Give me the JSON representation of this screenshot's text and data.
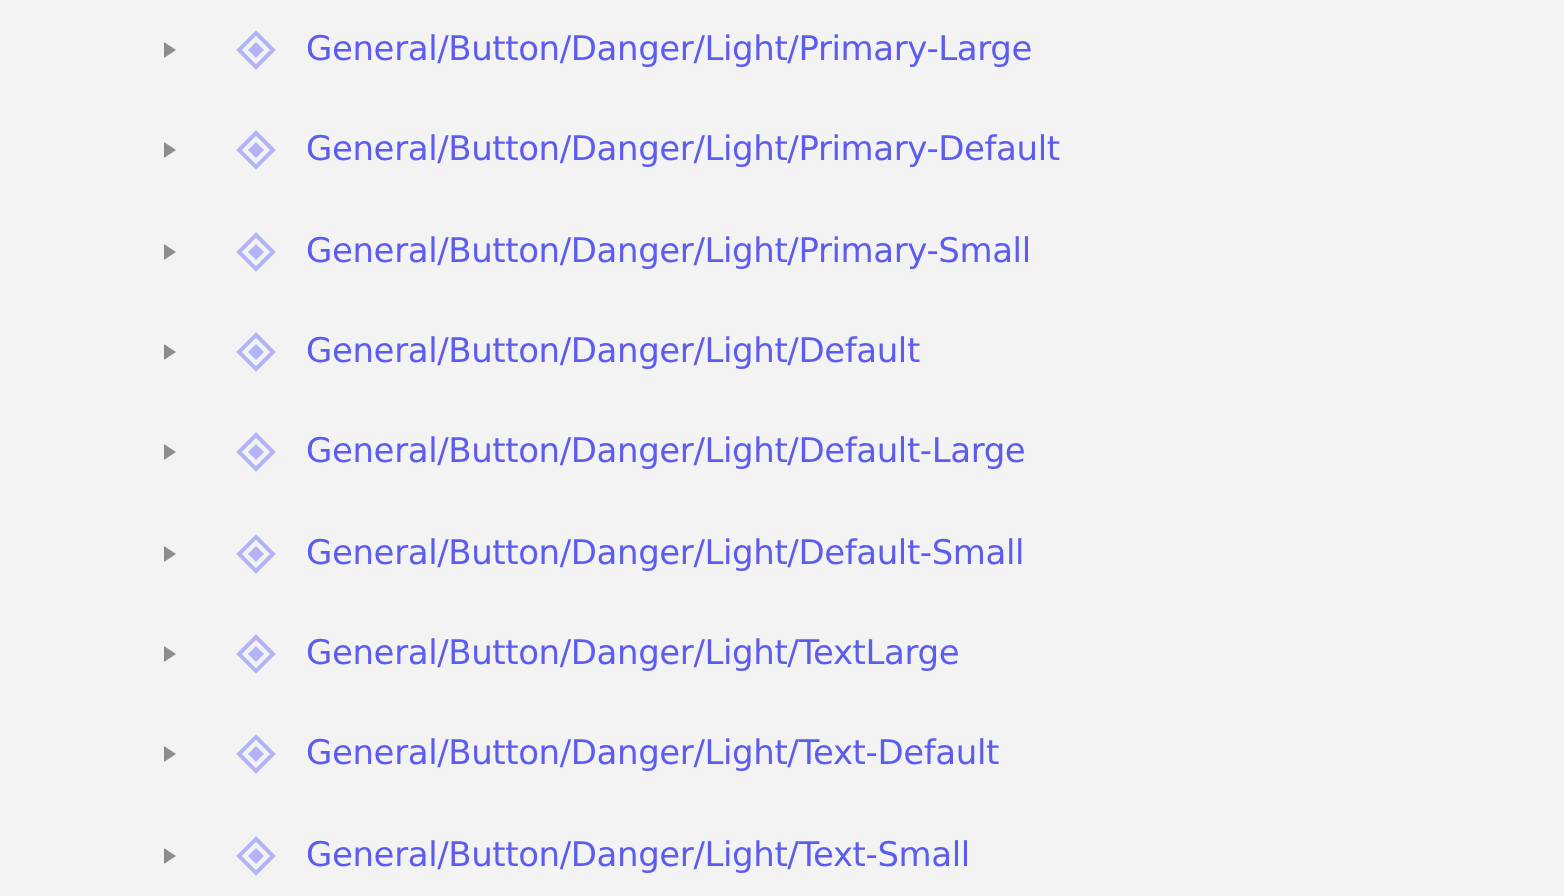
{
  "layers": [
    {
      "name": "General/Button/Danger/Light/Primary-Large",
      "expanded": false
    },
    {
      "name": "General/Button/Danger/Light/Primary-Default",
      "expanded": false
    },
    {
      "name": "General/Button/Danger/Light/Primary-Small",
      "expanded": false
    },
    {
      "name": "General/Button/Danger/Light/Default",
      "expanded": false
    },
    {
      "name": "General/Button/Danger/Light/Default-Large",
      "expanded": false
    },
    {
      "name": "General/Button/Danger/Light/Default-Small",
      "expanded": false
    },
    {
      "name": "General/Button/Danger/Light/TextLarge",
      "expanded": false
    },
    {
      "name": "General/Button/Danger/Light/Text-Default",
      "expanded": false
    },
    {
      "name": "General/Button/Danger/Light/Text-Small",
      "expanded": false
    }
  ]
}
